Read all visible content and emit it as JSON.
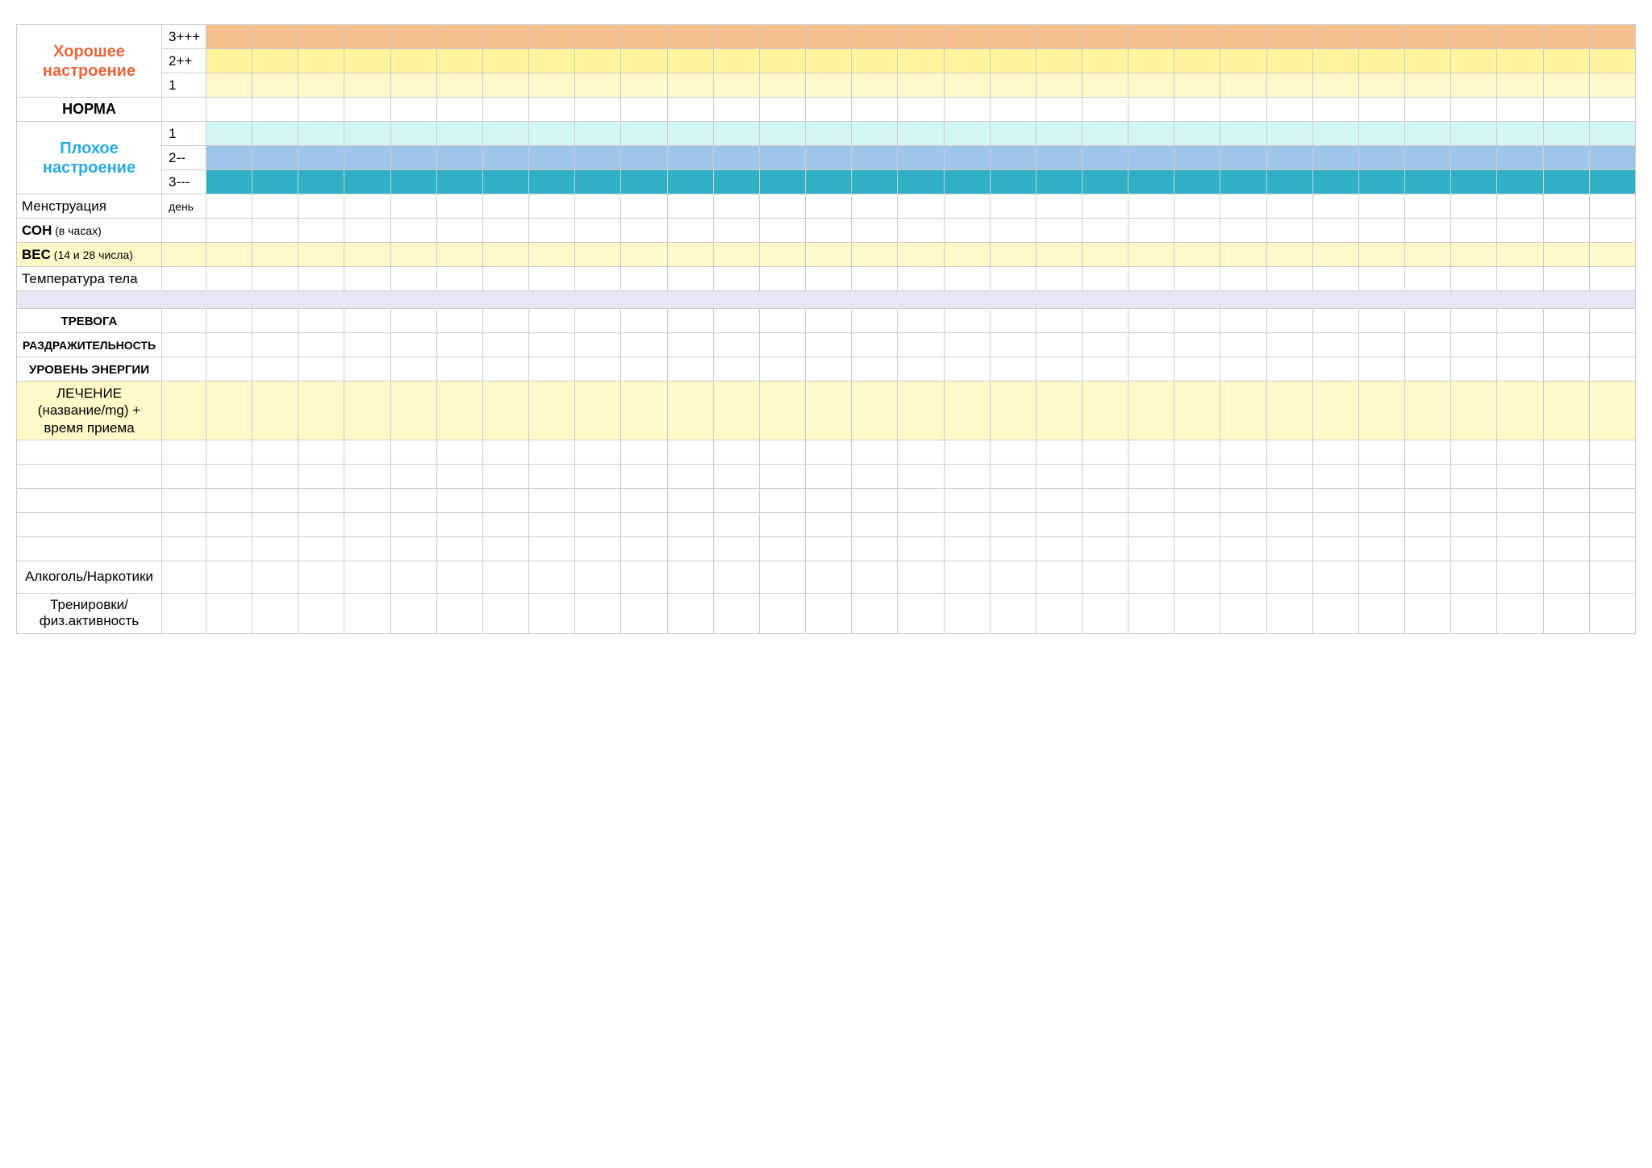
{
  "rows": {
    "good_mood": "Хорошее настроение",
    "good_3": "3+++",
    "good_2": "2++",
    "good_1": "1",
    "norm": "НОРМА",
    "bad_mood": "Плохое настроение",
    "bad_1": "1",
    "bad_2": "2--",
    "bad_3": "3---",
    "menstruation": "Менструация",
    "menstruation_sub": "день",
    "sleep_bold": "СОН",
    "sleep_note": " (в часах)",
    "weight_bold": "ВЕС",
    "weight_note": " (14 и 28 числа)",
    "temperature": "Температура тела",
    "anxiety": "ТРЕВОГА",
    "irritability": "РАЗДРАЖИТЕЛЬНОСТЬ",
    "energy": "УРОВЕНЬ ЭНЕРГИИ",
    "treatment_l1": "ЛЕЧЕНИЕ",
    "treatment_l2": "(название/mg) +",
    "treatment_l3": "время приема",
    "alcohol": "Алкоголь/Наркотики",
    "training_l1": "Тренировки/",
    "training_l2": "физ.активность"
  },
  "day_columns": 31
}
